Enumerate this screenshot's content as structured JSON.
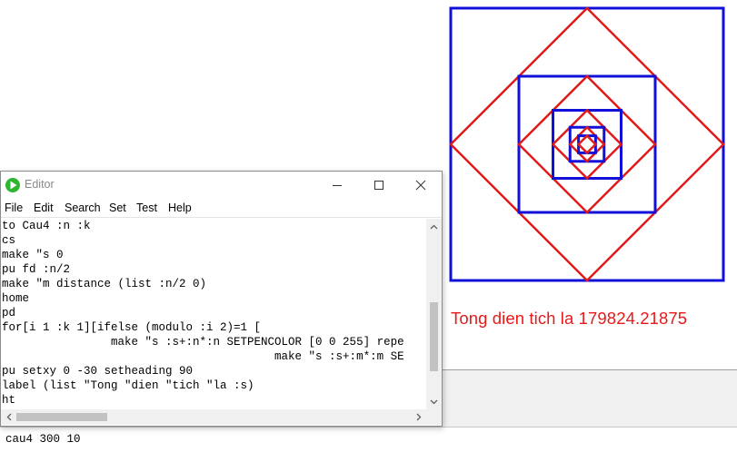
{
  "canvas": {
    "label": "Tong dien tich la 179824.21875",
    "colors": {
      "blue": "#1010d8",
      "red": "#e01a1a",
      "label": "#e81919"
    }
  },
  "editor": {
    "title": "Editor",
    "icon": "green-play-icon",
    "window_buttons": [
      "minimize-icon",
      "maximize-icon",
      "close-icon"
    ],
    "menu": [
      "File",
      "Edit",
      "Search",
      "Set",
      "Test",
      "Help"
    ],
    "code": [
      "to Cau4 :n :k",
      "cs",
      "make \"s 0",
      "pu fd :n/2",
      "make \"m distance (list :n/2 0)",
      "home",
      "pd",
      "for[i 1 :k 1][ifelse (modulo :i 2)=1 [",
      "                make \"s :s+:n*:n SETPENCOLOR [0 0 255] repe",
      "                                        make \"s :s+:m*:m SE",
      "pu setxy 0 -30 setheading 90",
      "label (list \"Tong \"dien \"tich \"la :s)",
      "ht"
    ]
  },
  "command_line": {
    "text": "cau4 300 10"
  }
}
